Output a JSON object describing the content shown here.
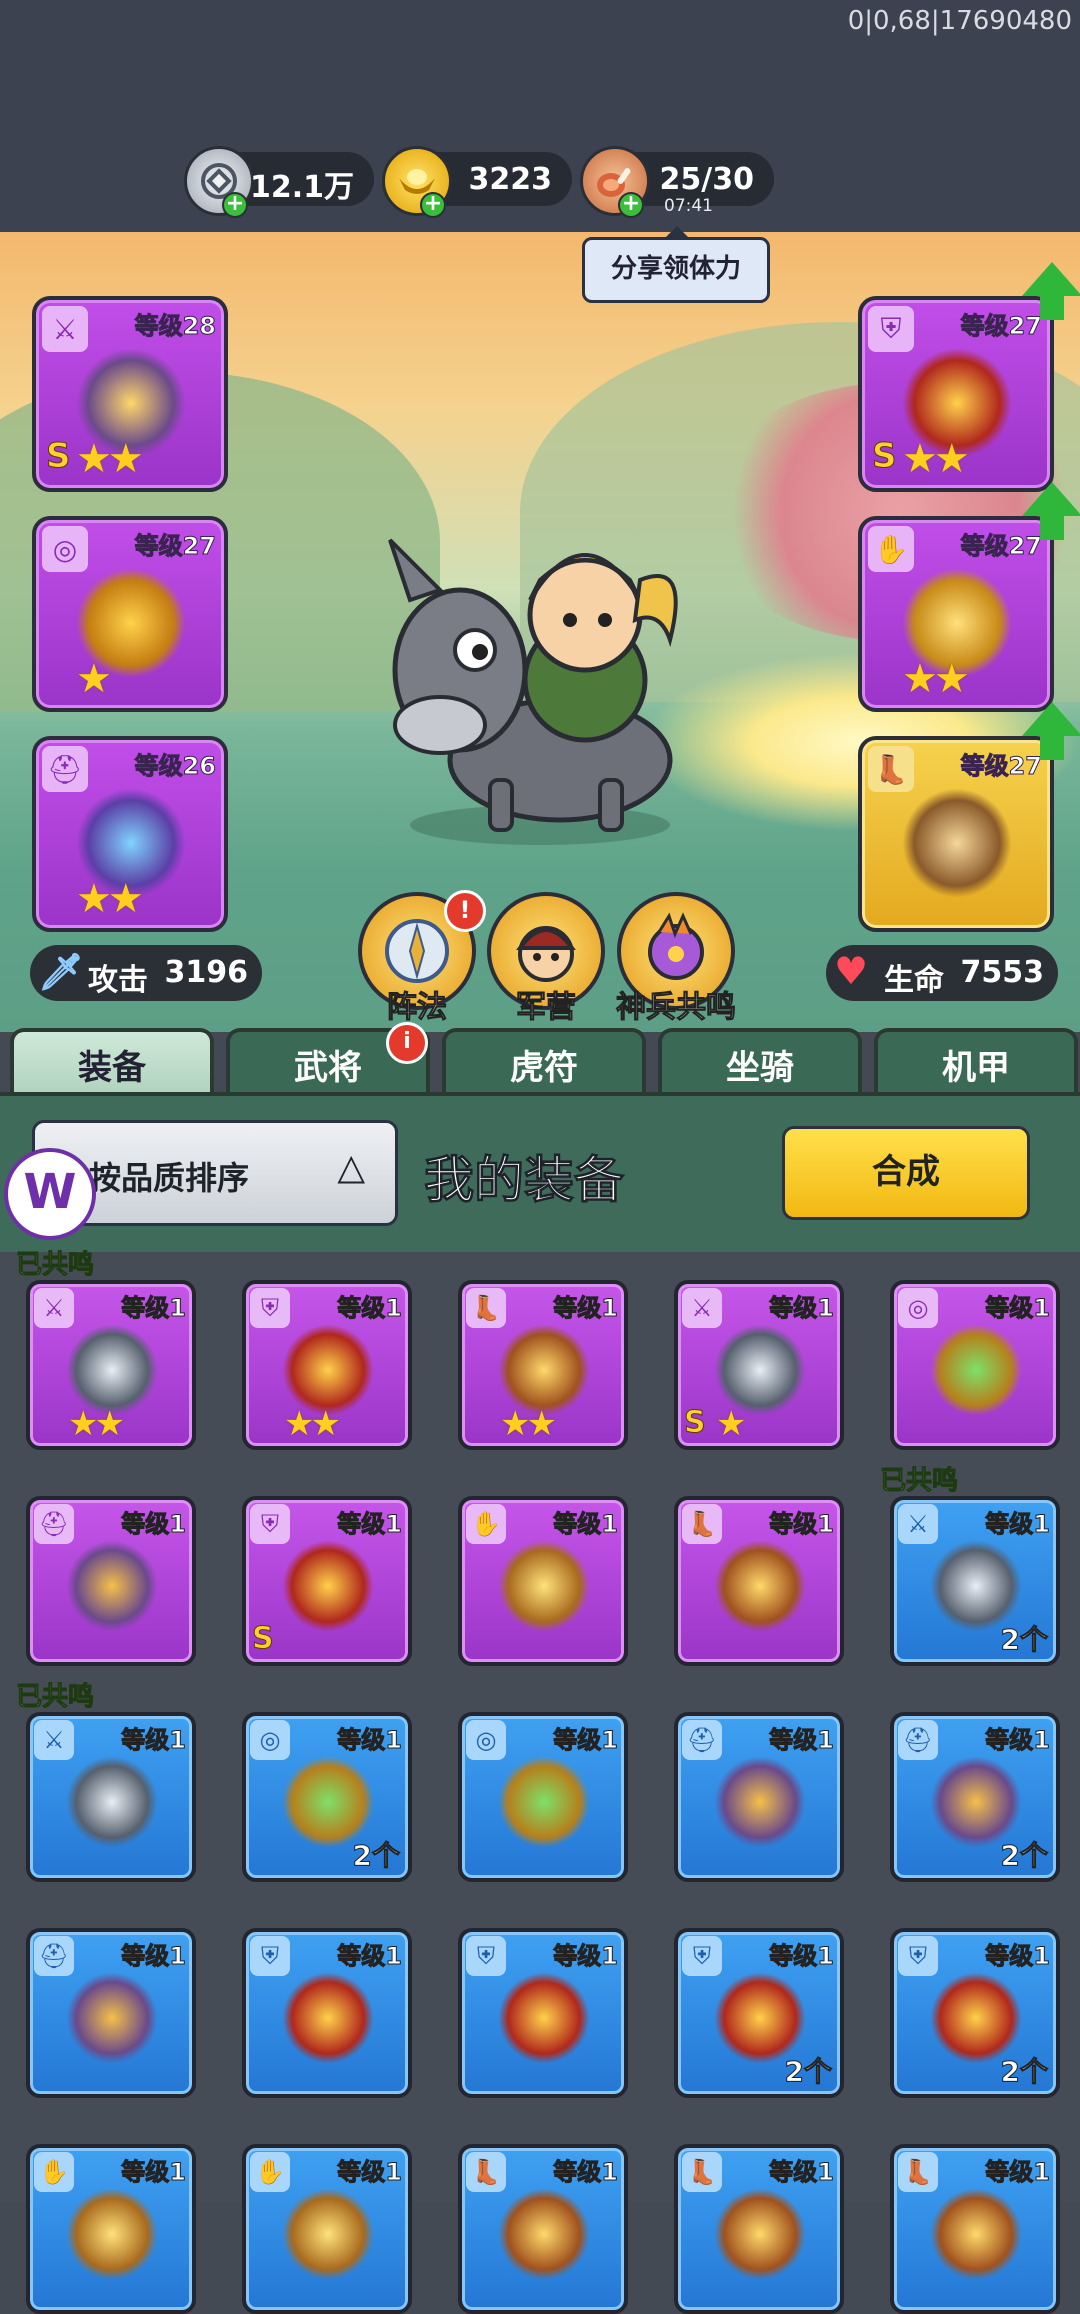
{
  "debug": "0|0,68|17690480",
  "resources": {
    "silver": {
      "value": "12.1万",
      "icon": "silver-coin-icon"
    },
    "gold": {
      "value": "3223",
      "icon": "gold-ingot-icon"
    },
    "stamina": {
      "value": "25/30",
      "timer": "07:41",
      "icon": "meat-icon"
    }
  },
  "share_button": "分享领体力",
  "equipped": {
    "left": [
      {
        "slot": "weapon",
        "level": "等级28",
        "rank": "S",
        "stars": "★★",
        "color": "#b43fe0"
      },
      {
        "slot": "amulet",
        "level": "等级27",
        "rank": "",
        "stars": "★",
        "color": "#b43fe0"
      },
      {
        "slot": "helmet",
        "level": "等级26",
        "rank": "",
        "stars": "★★",
        "color": "#b43fe0"
      }
    ],
    "right": [
      {
        "slot": "armor",
        "level": "等级27",
        "rank": "S",
        "stars": "★★",
        "color": "#b43fe0"
      },
      {
        "slot": "bracer",
        "level": "等级27",
        "rank": "",
        "stars": "★★",
        "color": "#b43fe0"
      },
      {
        "slot": "boots",
        "level": "等级27",
        "rank": "",
        "stars": "",
        "color": "#f2c33a"
      }
    ]
  },
  "stats": {
    "attack_label": "攻击",
    "attack_value": "3196",
    "hp_label": "生命",
    "hp_value": "7553"
  },
  "actions": [
    {
      "label": "阵法",
      "badge": "!"
    },
    {
      "label": "军营",
      "badge": ""
    },
    {
      "label": "神兵共鸣",
      "badge": ""
    }
  ],
  "tabs": [
    {
      "label": "装备",
      "active": true,
      "badge": ""
    },
    {
      "label": "武将",
      "active": false,
      "badge": "i"
    },
    {
      "label": "虎符",
      "active": false,
      "badge": ""
    },
    {
      "label": "坐骑",
      "active": false,
      "badge": ""
    },
    {
      "label": "机甲",
      "active": false,
      "badge": ""
    }
  ],
  "panel": {
    "sort_label": "按品质排序",
    "sort_icon": "triangle-up-icon",
    "title": "我的装备",
    "combine_label": "合成"
  },
  "resonance_label": "已共鸣",
  "inventory": [
    {
      "row": 0,
      "col": 0,
      "color": "purple",
      "slot": "weapon",
      "level": "等级1",
      "stars": "★★",
      "rank": "",
      "count": "",
      "resonated": true
    },
    {
      "row": 0,
      "col": 1,
      "color": "purple",
      "slot": "armor",
      "level": "等级1",
      "stars": "★★",
      "rank": "",
      "count": "",
      "resonated": false
    },
    {
      "row": 0,
      "col": 2,
      "color": "purple",
      "slot": "boots",
      "level": "等级1",
      "stars": "★★",
      "rank": "",
      "count": "",
      "resonated": false
    },
    {
      "row": 0,
      "col": 3,
      "color": "purple",
      "slot": "weapon",
      "level": "等级1",
      "stars": "★",
      "rank": "S",
      "count": "",
      "resonated": false
    },
    {
      "row": 0,
      "col": 4,
      "color": "purple",
      "slot": "amulet",
      "level": "等级1",
      "stars": "",
      "rank": "",
      "count": "",
      "resonated": false
    },
    {
      "row": 1,
      "col": 0,
      "color": "purple",
      "slot": "helmet",
      "level": "等级1",
      "stars": "",
      "rank": "",
      "count": "",
      "resonated": false
    },
    {
      "row": 1,
      "col": 1,
      "color": "purple",
      "slot": "armor",
      "level": "等级1",
      "stars": "",
      "rank": "S",
      "count": "",
      "resonated": false
    },
    {
      "row": 1,
      "col": 2,
      "color": "purple",
      "slot": "bracer",
      "level": "等级1",
      "stars": "",
      "rank": "",
      "count": "",
      "resonated": false
    },
    {
      "row": 1,
      "col": 3,
      "color": "purple",
      "slot": "boots",
      "level": "等级1",
      "stars": "",
      "rank": "",
      "count": "",
      "resonated": false
    },
    {
      "row": 1,
      "col": 4,
      "color": "blue",
      "slot": "weapon",
      "level": "等级1",
      "stars": "",
      "rank": "",
      "count": "2个",
      "resonated": true
    },
    {
      "row": 2,
      "col": 0,
      "color": "blue",
      "slot": "weapon",
      "level": "等级1",
      "stars": "",
      "rank": "",
      "count": "",
      "resonated": true
    },
    {
      "row": 2,
      "col": 1,
      "color": "blue",
      "slot": "amulet",
      "level": "等级1",
      "stars": "",
      "rank": "",
      "count": "2个",
      "resonated": false
    },
    {
      "row": 2,
      "col": 2,
      "color": "blue",
      "slot": "amulet",
      "level": "等级1",
      "stars": "",
      "rank": "",
      "count": "",
      "resonated": false
    },
    {
      "row": 2,
      "col": 3,
      "color": "blue",
      "slot": "helmet",
      "level": "等级1",
      "stars": "",
      "rank": "",
      "count": "",
      "resonated": false
    },
    {
      "row": 2,
      "col": 4,
      "color": "blue",
      "slot": "helmet",
      "level": "等级1",
      "stars": "",
      "rank": "",
      "count": "2个",
      "resonated": false
    },
    {
      "row": 3,
      "col": 0,
      "color": "blue",
      "slot": "helmet",
      "level": "等级1",
      "stars": "",
      "rank": "",
      "count": "",
      "resonated": false
    },
    {
      "row": 3,
      "col": 1,
      "color": "blue",
      "slot": "armor",
      "level": "等级1",
      "stars": "",
      "rank": "",
      "count": "",
      "resonated": false
    },
    {
      "row": 3,
      "col": 2,
      "color": "blue",
      "slot": "armor",
      "level": "等级1",
      "stars": "",
      "rank": "",
      "count": "",
      "resonated": false
    },
    {
      "row": 3,
      "col": 3,
      "color": "blue",
      "slot": "armor",
      "level": "等级1",
      "stars": "",
      "rank": "",
      "count": "2个",
      "resonated": false
    },
    {
      "row": 3,
      "col": 4,
      "color": "blue",
      "slot": "armor",
      "level": "等级1",
      "stars": "",
      "rank": "",
      "count": "2个",
      "resonated": false
    },
    {
      "row": 4,
      "col": 0,
      "color": "blue",
      "slot": "bracer",
      "level": "等级1",
      "stars": "",
      "rank": "",
      "count": "",
      "resonated": false
    },
    {
      "row": 4,
      "col": 1,
      "color": "blue",
      "slot": "bracer",
      "level": "等级1",
      "stars": "",
      "rank": "",
      "count": "",
      "resonated": false
    },
    {
      "row": 4,
      "col": 2,
      "color": "blue",
      "slot": "boots",
      "level": "等级1",
      "stars": "",
      "rank": "",
      "count": "",
      "resonated": false
    },
    {
      "row": 4,
      "col": 3,
      "color": "blue",
      "slot": "boots",
      "level": "等级1",
      "stars": "",
      "rank": "",
      "count": "",
      "resonated": false
    },
    {
      "row": 4,
      "col": 4,
      "color": "blue",
      "slot": "boots",
      "level": "等级1",
      "stars": "",
      "rank": "",
      "count": "",
      "resonated": false
    }
  ]
}
